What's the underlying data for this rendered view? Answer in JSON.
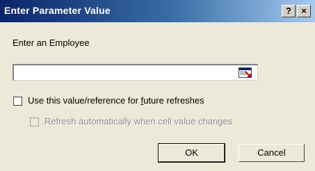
{
  "window": {
    "title": "Enter Parameter Value",
    "help_label": "?",
    "close_label": "×"
  },
  "prompt": {
    "label": "Enter an Employee",
    "value": ""
  },
  "options": {
    "use_value_label_before": "Use this value/reference for ",
    "use_value_label_underlined": "f",
    "use_value_label_after": "uture refreshes",
    "use_value_checked": false,
    "refresh_auto_label": "Refresh automatically when cell value changes",
    "refresh_auto_checked": false,
    "refresh_auto_enabled": false
  },
  "buttons": {
    "ok_label": "OK",
    "cancel_label": "Cancel"
  },
  "colors": {
    "dialog_bg": "#ece9d8",
    "title_start": "#0a246a",
    "title_end": "#a6caf0"
  },
  "icons": {
    "ref": "collapse-dialog-icon"
  }
}
